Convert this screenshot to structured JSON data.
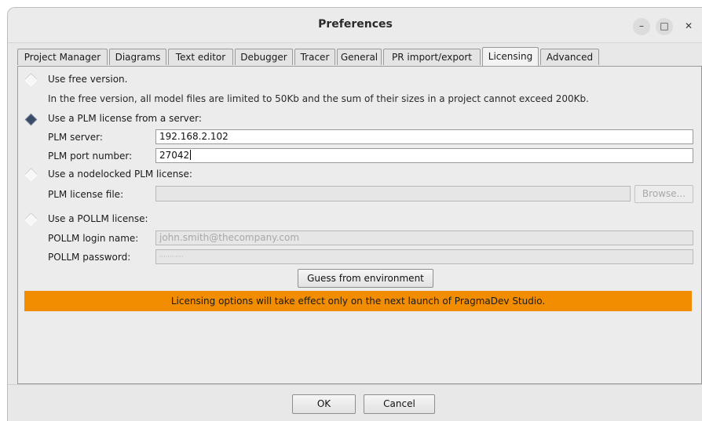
{
  "window": {
    "title": "Preferences",
    "controls": {
      "minimize": "–",
      "maximize": "□",
      "close": "✕"
    }
  },
  "tabs": [
    {
      "label": "Project Manager"
    },
    {
      "label": "Diagrams"
    },
    {
      "label": "Text editor"
    },
    {
      "label": "Debugger"
    },
    {
      "label": "Tracer"
    },
    {
      "label": "General"
    },
    {
      "label": "PR import/export"
    },
    {
      "label": "Licensing",
      "selected": true
    },
    {
      "label": "Advanced"
    }
  ],
  "licensing": {
    "free": {
      "label": "Use free version.",
      "checked": false,
      "note": "In the free version, all model files are limited to 50Kb and the sum of their sizes in a project cannot exceed 200Kb."
    },
    "plm_server": {
      "label": "Use a PLM license from a server:",
      "checked": true,
      "server_label": "PLM server:",
      "server_value": "192.168.2.102",
      "port_label": "PLM port number:",
      "port_value": "27042"
    },
    "nodelocked": {
      "label": "Use a nodelocked PLM license:",
      "checked": false,
      "file_label": "PLM license file:",
      "file_value": "",
      "browse_label": "Browse..."
    },
    "pollm": {
      "label": "Use a POLLM license:",
      "checked": false,
      "login_label": "POLLM login name:",
      "login_placeholder": "john.smith@thecompany.com",
      "password_label": "POLLM password:",
      "password_mask": "············"
    },
    "guess_label": "Guess from environment",
    "banner_text": "Licensing options will take effect only on the next launch of PragmaDev Studio.",
    "banner_color": "#f28c00"
  },
  "footer": {
    "ok_label": "OK",
    "cancel_label": "Cancel"
  }
}
